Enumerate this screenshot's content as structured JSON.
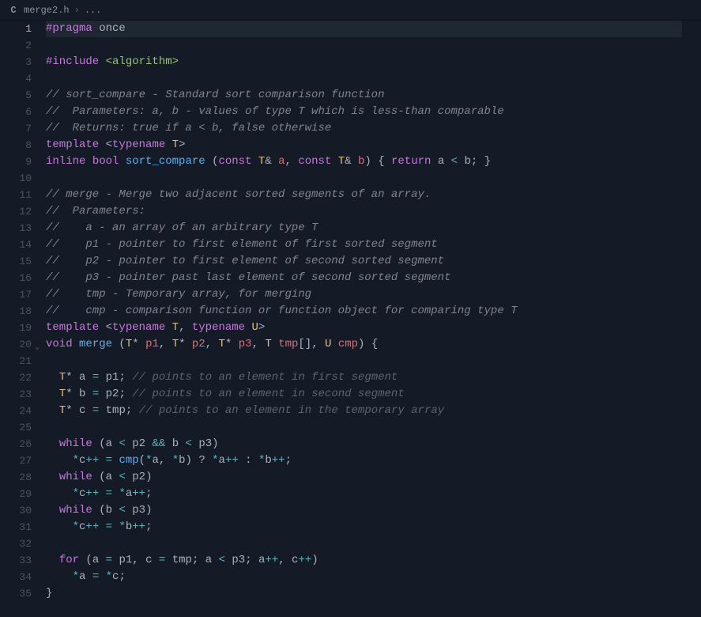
{
  "breadcrumb": {
    "filename": "merge2.h",
    "more": "..."
  },
  "active_line": 1,
  "fold_line": 20,
  "lines": [
    {
      "n": 1,
      "tokens": [
        {
          "t": "#pragma",
          "c": "c-directive"
        },
        {
          "t": " ",
          "c": "c-default"
        },
        {
          "t": "once",
          "c": "c-default"
        }
      ]
    },
    {
      "n": 2,
      "tokens": []
    },
    {
      "n": 3,
      "tokens": [
        {
          "t": "#include",
          "c": "c-directive"
        },
        {
          "t": " ",
          "c": "c-default"
        },
        {
          "t": "<algorithm>",
          "c": "c-include"
        }
      ]
    },
    {
      "n": 4,
      "tokens": []
    },
    {
      "n": 5,
      "tokens": [
        {
          "t": "// sort_compare - Standard sort comparison function",
          "c": "c-comment-doc"
        }
      ]
    },
    {
      "n": 6,
      "tokens": [
        {
          "t": "//  Parameters: a, b - values of type T which is less-than comparable",
          "c": "c-comment-doc"
        }
      ]
    },
    {
      "n": 7,
      "tokens": [
        {
          "t": "//  Returns: true if a < b, false otherwise",
          "c": "c-comment-doc"
        }
      ]
    },
    {
      "n": 8,
      "tokens": [
        {
          "t": "template",
          "c": "c-keyword"
        },
        {
          "t": " <",
          "c": "c-punct"
        },
        {
          "t": "typename",
          "c": "c-keyword"
        },
        {
          "t": " ",
          "c": "c-default"
        },
        {
          "t": "T",
          "c": "c-typename"
        },
        {
          "t": ">",
          "c": "c-punct"
        }
      ]
    },
    {
      "n": 9,
      "tokens": [
        {
          "t": "inline",
          "c": "c-keyword"
        },
        {
          "t": " ",
          "c": "c-default"
        },
        {
          "t": "bool",
          "c": "c-keyword"
        },
        {
          "t": " ",
          "c": "c-default"
        },
        {
          "t": "sort_compare",
          "c": "c-func"
        },
        {
          "t": " (",
          "c": "c-punct"
        },
        {
          "t": "const",
          "c": "c-keyword"
        },
        {
          "t": " ",
          "c": "c-default"
        },
        {
          "t": "T",
          "c": "c-typename"
        },
        {
          "t": "& ",
          "c": "c-punct"
        },
        {
          "t": "a",
          "c": "c-param"
        },
        {
          "t": ", ",
          "c": "c-punct"
        },
        {
          "t": "const",
          "c": "c-keyword"
        },
        {
          "t": " ",
          "c": "c-default"
        },
        {
          "t": "T",
          "c": "c-typename"
        },
        {
          "t": "& ",
          "c": "c-punct"
        },
        {
          "t": "b",
          "c": "c-param"
        },
        {
          "t": ") { ",
          "c": "c-punct"
        },
        {
          "t": "return",
          "c": "c-keyword"
        },
        {
          "t": " ",
          "c": "c-default"
        },
        {
          "t": "a",
          "c": "c-default"
        },
        {
          "t": " < ",
          "c": "c-op"
        },
        {
          "t": "b",
          "c": "c-default"
        },
        {
          "t": "; }",
          "c": "c-punct"
        }
      ]
    },
    {
      "n": 10,
      "tokens": []
    },
    {
      "n": 11,
      "tokens": [
        {
          "t": "// merge - Merge two adjacent sorted segments of an array.",
          "c": "c-comment-doc"
        }
      ]
    },
    {
      "n": 12,
      "tokens": [
        {
          "t": "//  Parameters:",
          "c": "c-comment-doc"
        }
      ]
    },
    {
      "n": 13,
      "tokens": [
        {
          "t": "//    a - an array of an arbitrary type T",
          "c": "c-comment-doc"
        }
      ]
    },
    {
      "n": 14,
      "tokens": [
        {
          "t": "//    p1 - pointer to first element of first sorted segment",
          "c": "c-comment-doc"
        }
      ]
    },
    {
      "n": 15,
      "tokens": [
        {
          "t": "//    p2 - pointer to first element of second sorted segment",
          "c": "c-comment-doc"
        }
      ]
    },
    {
      "n": 16,
      "tokens": [
        {
          "t": "//    p3 - pointer past last element of second sorted segment",
          "c": "c-comment-doc"
        }
      ]
    },
    {
      "n": 17,
      "tokens": [
        {
          "t": "//    tmp - Temporary array, for merging",
          "c": "c-comment-doc"
        }
      ]
    },
    {
      "n": 18,
      "tokens": [
        {
          "t": "//    cmp - comparison function or function object for comparing type T",
          "c": "c-comment-doc"
        }
      ]
    },
    {
      "n": 19,
      "tokens": [
        {
          "t": "template",
          "c": "c-keyword"
        },
        {
          "t": " <",
          "c": "c-punct"
        },
        {
          "t": "typename",
          "c": "c-keyword"
        },
        {
          "t": " ",
          "c": "c-default"
        },
        {
          "t": "T",
          "c": "c-typename"
        },
        {
          "t": ", ",
          "c": "c-punct"
        },
        {
          "t": "typename",
          "c": "c-keyword"
        },
        {
          "t": " ",
          "c": "c-default"
        },
        {
          "t": "U",
          "c": "c-typename"
        },
        {
          "t": ">",
          "c": "c-punct"
        }
      ]
    },
    {
      "n": 20,
      "tokens": [
        {
          "t": "void",
          "c": "c-keyword"
        },
        {
          "t": " ",
          "c": "c-default"
        },
        {
          "t": "merge",
          "c": "c-func"
        },
        {
          "t": " (",
          "c": "c-punct"
        },
        {
          "t": "T",
          "c": "c-typename"
        },
        {
          "t": "* ",
          "c": "c-punct"
        },
        {
          "t": "p1",
          "c": "c-param"
        },
        {
          "t": ", ",
          "c": "c-punct"
        },
        {
          "t": "T",
          "c": "c-typename"
        },
        {
          "t": "* ",
          "c": "c-punct"
        },
        {
          "t": "p2",
          "c": "c-param"
        },
        {
          "t": ", ",
          "c": "c-punct"
        },
        {
          "t": "T",
          "c": "c-typename"
        },
        {
          "t": "* ",
          "c": "c-punct"
        },
        {
          "t": "p3",
          "c": "c-param"
        },
        {
          "t": ", ",
          "c": "c-punct"
        },
        {
          "t": "T",
          "c": "c-typename"
        },
        {
          "t": " ",
          "c": "c-default"
        },
        {
          "t": "tmp",
          "c": "c-param"
        },
        {
          "t": "[], ",
          "c": "c-punct"
        },
        {
          "t": "U",
          "c": "c-typename"
        },
        {
          "t": " ",
          "c": "c-default"
        },
        {
          "t": "cmp",
          "c": "c-param"
        },
        {
          "t": ") {",
          "c": "c-punct"
        }
      ]
    },
    {
      "n": 21,
      "tokens": []
    },
    {
      "n": 22,
      "tokens": [
        {
          "t": "  ",
          "c": "c-default"
        },
        {
          "t": "T",
          "c": "c-typename"
        },
        {
          "t": "* ",
          "c": "c-punct"
        },
        {
          "t": "a",
          "c": "c-default"
        },
        {
          "t": " = ",
          "c": "c-op"
        },
        {
          "t": "p1",
          "c": "c-default"
        },
        {
          "t": "; ",
          "c": "c-punct"
        },
        {
          "t": "// points to an element in first segment",
          "c": "c-comment"
        }
      ]
    },
    {
      "n": 23,
      "tokens": [
        {
          "t": "  ",
          "c": "c-default"
        },
        {
          "t": "T",
          "c": "c-typename"
        },
        {
          "t": "* ",
          "c": "c-punct"
        },
        {
          "t": "b",
          "c": "c-default"
        },
        {
          "t": " = ",
          "c": "c-op"
        },
        {
          "t": "p2",
          "c": "c-default"
        },
        {
          "t": "; ",
          "c": "c-punct"
        },
        {
          "t": "// points to an element in second segment",
          "c": "c-comment"
        }
      ]
    },
    {
      "n": 24,
      "tokens": [
        {
          "t": "  ",
          "c": "c-default"
        },
        {
          "t": "T",
          "c": "c-typename"
        },
        {
          "t": "* ",
          "c": "c-punct"
        },
        {
          "t": "c",
          "c": "c-default"
        },
        {
          "t": " = ",
          "c": "c-op"
        },
        {
          "t": "tmp",
          "c": "c-default"
        },
        {
          "t": "; ",
          "c": "c-punct"
        },
        {
          "t": "// points to an element in the temporary array",
          "c": "c-comment"
        }
      ]
    },
    {
      "n": 25,
      "tokens": []
    },
    {
      "n": 26,
      "tokens": [
        {
          "t": "  ",
          "c": "c-default"
        },
        {
          "t": "while",
          "c": "c-keyword"
        },
        {
          "t": " (",
          "c": "c-punct"
        },
        {
          "t": "a",
          "c": "c-default"
        },
        {
          "t": " < ",
          "c": "c-op"
        },
        {
          "t": "p2",
          "c": "c-default"
        },
        {
          "t": " && ",
          "c": "c-op"
        },
        {
          "t": "b",
          "c": "c-default"
        },
        {
          "t": " < ",
          "c": "c-op"
        },
        {
          "t": "p3",
          "c": "c-default"
        },
        {
          "t": ")",
          "c": "c-punct"
        }
      ]
    },
    {
      "n": 27,
      "tokens": [
        {
          "t": "    ",
          "c": "c-default"
        },
        {
          "t": "*",
          "c": "c-op"
        },
        {
          "t": "c",
          "c": "c-default"
        },
        {
          "t": "++",
          "c": "c-op"
        },
        {
          "t": " = ",
          "c": "c-op"
        },
        {
          "t": "cmp",
          "c": "c-func"
        },
        {
          "t": "(",
          "c": "c-punct"
        },
        {
          "t": "*",
          "c": "c-op"
        },
        {
          "t": "a",
          "c": "c-default"
        },
        {
          "t": ", ",
          "c": "c-punct"
        },
        {
          "t": "*",
          "c": "c-op"
        },
        {
          "t": "b",
          "c": "c-default"
        },
        {
          "t": ") ? ",
          "c": "c-punct"
        },
        {
          "t": "*",
          "c": "c-op"
        },
        {
          "t": "a",
          "c": "c-default"
        },
        {
          "t": "++",
          "c": "c-op"
        },
        {
          "t": " : ",
          "c": "c-punct"
        },
        {
          "t": "*",
          "c": "c-op"
        },
        {
          "t": "b",
          "c": "c-default"
        },
        {
          "t": "++",
          "c": "c-op"
        },
        {
          "t": ";",
          "c": "c-punct"
        }
      ]
    },
    {
      "n": 28,
      "tokens": [
        {
          "t": "  ",
          "c": "c-default"
        },
        {
          "t": "while",
          "c": "c-keyword"
        },
        {
          "t": " (",
          "c": "c-punct"
        },
        {
          "t": "a",
          "c": "c-default"
        },
        {
          "t": " < ",
          "c": "c-op"
        },
        {
          "t": "p2",
          "c": "c-default"
        },
        {
          "t": ")",
          "c": "c-punct"
        }
      ]
    },
    {
      "n": 29,
      "tokens": [
        {
          "t": "    ",
          "c": "c-default"
        },
        {
          "t": "*",
          "c": "c-op"
        },
        {
          "t": "c",
          "c": "c-default"
        },
        {
          "t": "++",
          "c": "c-op"
        },
        {
          "t": " = ",
          "c": "c-op"
        },
        {
          "t": "*",
          "c": "c-op"
        },
        {
          "t": "a",
          "c": "c-default"
        },
        {
          "t": "++",
          "c": "c-op"
        },
        {
          "t": ";",
          "c": "c-punct"
        }
      ]
    },
    {
      "n": 30,
      "tokens": [
        {
          "t": "  ",
          "c": "c-default"
        },
        {
          "t": "while",
          "c": "c-keyword"
        },
        {
          "t": " (",
          "c": "c-punct"
        },
        {
          "t": "b",
          "c": "c-default"
        },
        {
          "t": " < ",
          "c": "c-op"
        },
        {
          "t": "p3",
          "c": "c-default"
        },
        {
          "t": ")",
          "c": "c-punct"
        }
      ]
    },
    {
      "n": 31,
      "tokens": [
        {
          "t": "    ",
          "c": "c-default"
        },
        {
          "t": "*",
          "c": "c-op"
        },
        {
          "t": "c",
          "c": "c-default"
        },
        {
          "t": "++",
          "c": "c-op"
        },
        {
          "t": " = ",
          "c": "c-op"
        },
        {
          "t": "*",
          "c": "c-op"
        },
        {
          "t": "b",
          "c": "c-default"
        },
        {
          "t": "++",
          "c": "c-op"
        },
        {
          "t": ";",
          "c": "c-punct"
        }
      ]
    },
    {
      "n": 32,
      "tokens": []
    },
    {
      "n": 33,
      "tokens": [
        {
          "t": "  ",
          "c": "c-default"
        },
        {
          "t": "for",
          "c": "c-keyword"
        },
        {
          "t": " (",
          "c": "c-punct"
        },
        {
          "t": "a",
          "c": "c-default"
        },
        {
          "t": " = ",
          "c": "c-op"
        },
        {
          "t": "p1",
          "c": "c-default"
        },
        {
          "t": ", ",
          "c": "c-punct"
        },
        {
          "t": "c",
          "c": "c-default"
        },
        {
          "t": " = ",
          "c": "c-op"
        },
        {
          "t": "tmp",
          "c": "c-default"
        },
        {
          "t": "; ",
          "c": "c-punct"
        },
        {
          "t": "a",
          "c": "c-default"
        },
        {
          "t": " < ",
          "c": "c-op"
        },
        {
          "t": "p3",
          "c": "c-default"
        },
        {
          "t": "; ",
          "c": "c-punct"
        },
        {
          "t": "a",
          "c": "c-default"
        },
        {
          "t": "++",
          "c": "c-op"
        },
        {
          "t": ", ",
          "c": "c-punct"
        },
        {
          "t": "c",
          "c": "c-default"
        },
        {
          "t": "++",
          "c": "c-op"
        },
        {
          "t": ")",
          "c": "c-punct"
        }
      ]
    },
    {
      "n": 34,
      "tokens": [
        {
          "t": "    ",
          "c": "c-default"
        },
        {
          "t": "*",
          "c": "c-op"
        },
        {
          "t": "a",
          "c": "c-default"
        },
        {
          "t": " = ",
          "c": "c-op"
        },
        {
          "t": "*",
          "c": "c-op"
        },
        {
          "t": "c",
          "c": "c-default"
        },
        {
          "t": ";",
          "c": "c-punct"
        }
      ]
    },
    {
      "n": 35,
      "tokens": [
        {
          "t": "}",
          "c": "c-punct"
        }
      ]
    }
  ]
}
